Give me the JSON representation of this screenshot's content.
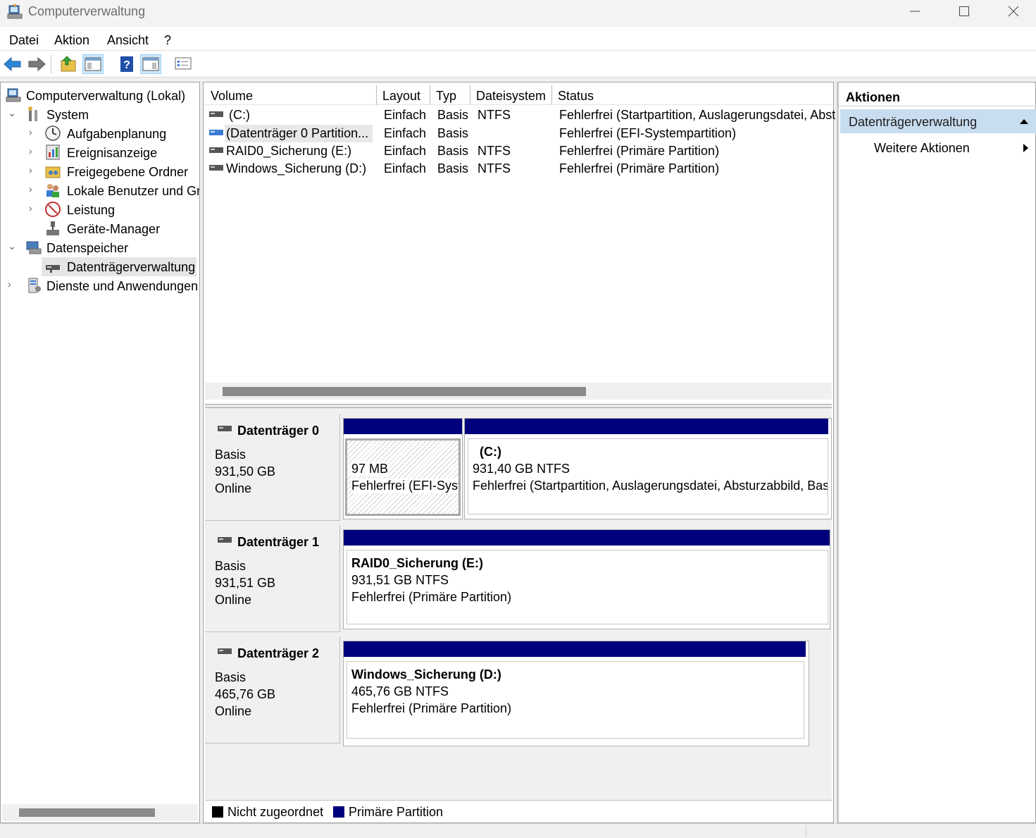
{
  "window": {
    "title": "Computerverwaltung"
  },
  "menu": [
    "Datei",
    "Aktion",
    "Ansicht",
    "?"
  ],
  "toolbar": {
    "buttons": [
      "back-icon",
      "forward-icon",
      "up-folder-icon",
      "show-hide-tree-icon",
      "help-icon",
      "show-hide-action-pane-icon",
      "properties-icon"
    ]
  },
  "tree": {
    "root": "Computerverwaltung (Lokal)",
    "system": "System",
    "aufgabenplanung": "Aufgabenplanung",
    "ereignisanzeige": "Ereignisanzeige",
    "freigegebene_ordner": "Freigegebene Ordner",
    "lokale_benutzer": "Lokale Benutzer und Gru",
    "leistung": "Leistung",
    "geraete_manager": "Geräte-Manager",
    "datenspeicher": "Datenspeicher",
    "datentraegerverwaltung": "Datenträgerverwaltung",
    "dienste": "Dienste und Anwendungen"
  },
  "volume_list": {
    "columns": [
      "Volume",
      "Layout",
      "Typ",
      "Dateisystem",
      "Status"
    ],
    "rows": [
      {
        "volume": "(C:)",
        "layout": "Einfach",
        "typ": "Basis",
        "fs": "NTFS",
        "status": "Fehlerfrei (Startpartition, Auslagerungsdatei, Abst"
      },
      {
        "volume": "(Datenträger 0 Partition...",
        "layout": "Einfach",
        "typ": "Basis",
        "fs": "",
        "status": "Fehlerfrei (EFI-Systempartition)"
      },
      {
        "volume": "RAID0_Sicherung (E:)",
        "layout": "Einfach",
        "typ": "Basis",
        "fs": "NTFS",
        "status": "Fehlerfrei (Primäre Partition)"
      },
      {
        "volume": "Windows_Sicherung (D:)",
        "layout": "Einfach",
        "typ": "Basis",
        "fs": "NTFS",
        "status": "Fehlerfrei (Primäre Partition)"
      }
    ]
  },
  "disks": [
    {
      "name": "Datenträger 0",
      "type": "Basis",
      "size": "931,50 GB",
      "state": "Online",
      "partitions": [
        {
          "title": "",
          "size": "97 MB",
          "status": "Fehlerfrei (EFI-Syst"
        },
        {
          "title": "(C:)",
          "size": "931,40 GB NTFS",
          "status": "Fehlerfrei (Startpartition, Auslagerungsdatei, Absturzabbild, Bas"
        }
      ]
    },
    {
      "name": "Datenträger 1",
      "type": "Basis",
      "size": "931,51 GB",
      "state": "Online",
      "partitions": [
        {
          "title": "RAID0_Sicherung  (E:)",
          "size": "931,51 GB NTFS",
          "status": "Fehlerfrei (Primäre Partition)"
        }
      ]
    },
    {
      "name": "Datenträger 2",
      "type": "Basis",
      "size": "465,76 GB",
      "state": "Online",
      "partitions": [
        {
          "title": "Windows_Sicherung  (D:)",
          "size": "465,76 GB NTFS",
          "status": "Fehlerfrei (Primäre Partition)"
        }
      ]
    }
  ],
  "legend": {
    "unallocated": "Nicht zugeordnet",
    "primary": "Primäre Partition",
    "unallocated_color": "#000000",
    "primary_color": "#00007c"
  },
  "actions": {
    "header": "Aktionen",
    "section": "Datenträgerverwaltung",
    "item": "Weitere Aktionen"
  }
}
